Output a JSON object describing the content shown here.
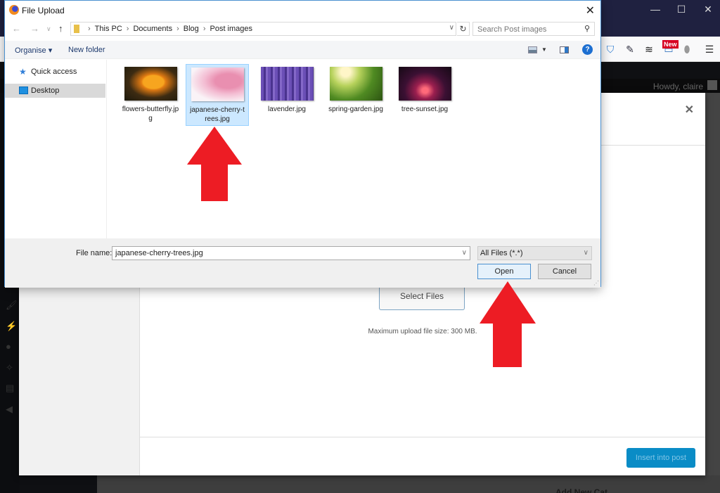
{
  "browser": {
    "window_controls": {
      "minimize": "—",
      "maximize": "☐",
      "close": "✕"
    },
    "toolbar_icons": [
      "shield-check-icon",
      "eyedropper-icon",
      "layers-icon",
      "screenshot-icon",
      "privacy-badger-icon",
      "hamburger-menu-icon"
    ],
    "new_badge": "New"
  },
  "wp": {
    "howdy": "Howdy, claire",
    "bottom_text": "Add New Cat"
  },
  "media_modal": {
    "close": "✕",
    "select_files": "Select Files",
    "max_upload": "Maximum upload file size: 300 MB.",
    "insert_button": "Insert into post",
    "accent": "#0a8cc6"
  },
  "dialog": {
    "title": "File Upload",
    "close": "✕",
    "breadcrumbs": [
      "This PC",
      "Documents",
      "Blog",
      "Post images"
    ],
    "search_placeholder": "Search Post images",
    "toolbar": {
      "organise": "Organise ▾",
      "new_folder": "New folder"
    },
    "nav_items": [
      {
        "label": "Quick access",
        "icon": "star-icon",
        "selected": false
      },
      {
        "label": "Desktop",
        "icon": "desktop-icon",
        "selected": true
      }
    ],
    "files": [
      {
        "name": "flowers-butterfly.jpg",
        "selected": false
      },
      {
        "name": "japanese-cherry-trees.jpg",
        "selected": true
      },
      {
        "name": "lavender.jpg",
        "selected": false
      },
      {
        "name": "spring-garden.jpg",
        "selected": false
      },
      {
        "name": "tree-sunset.jpg",
        "selected": false
      }
    ],
    "file_name_label": "File name:",
    "file_name_value": "japanese-cherry-trees.jpg",
    "filter": "All Files (*.*)",
    "open": "Open",
    "cancel": "Cancel"
  },
  "annotation_color": "#ed1c24"
}
